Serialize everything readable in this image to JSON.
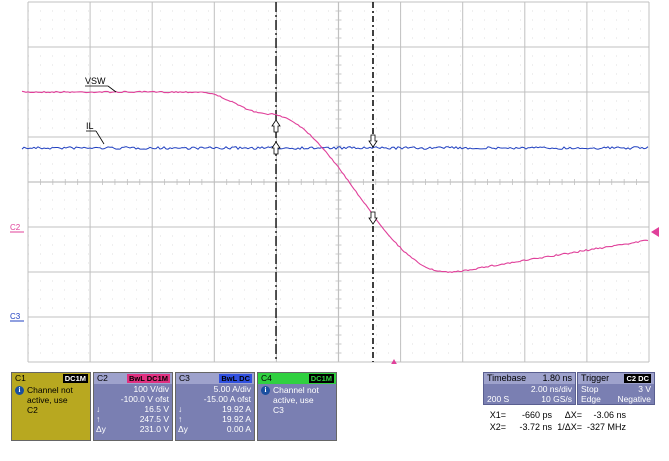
{
  "traces": {
    "vsw_label": "VSW",
    "il_label": "IL",
    "c2_label": "C2",
    "c3_label": "C3"
  },
  "colors": {
    "grid": "#c0c0c0",
    "vsw": "#e0409a",
    "il": "#2040c0",
    "c1_panel": "#b8a820",
    "c2_panel": "#7a7fb2",
    "c3_panel": "#7a7fb2",
    "c4_panel": "#7a7fb2",
    "c2_badge": "#e03080",
    "c3_badge": "#3050e0",
    "c4_badge": "#30d040"
  },
  "panels": {
    "c1": {
      "name": "C1",
      "badge": "DC1M",
      "line1": "Channel not",
      "line2": "active, use",
      "line3": "C2"
    },
    "c2": {
      "name": "C2",
      "badge": "BwL DC1M",
      "scale": "100 V/div",
      "offset": "-100.0 V ofst",
      "r1_sym": "↓",
      "r1_val": "16.5 V",
      "r2_sym": "↑",
      "r2_val": "247.5 V",
      "r3_sym": "Δy",
      "r3_val": "231.0 V"
    },
    "c3": {
      "name": "C3",
      "badge": "BwL DC",
      "scale": "5.00 A/div",
      "offset": "-15.00 A ofst",
      "r1_sym": "↓",
      "r1_val": "19.92 A",
      "r2_sym": "↑",
      "r2_val": "19.92 A",
      "r3_sym": "Δy",
      "r3_val": "0.00 A"
    },
    "c4": {
      "name": "C4",
      "badge": "DC1M",
      "line1": "Channel not",
      "line2": "active, use",
      "line3": "C3"
    }
  },
  "timebase": {
    "label": "Timebase",
    "value": "1.80 ns",
    "div": "2.00 ns/div",
    "samples": "200 S",
    "rate": "10 GS/s"
  },
  "trigger": {
    "label": "Trigger",
    "badge": "C2 DC",
    "mode": "Stop",
    "level": "3 V",
    "type": "Edge",
    "slope": "Negative"
  },
  "cursors": {
    "x1_label": "X1=",
    "x1_val": "-660 ps",
    "dx_label": "ΔX=",
    "dx_val": "-3.06 ns",
    "x2_label": "X2=",
    "x2_val": "-3.72 ns",
    "inv_label": "1/ΔX=",
    "inv_val": "-327 MHz"
  }
}
